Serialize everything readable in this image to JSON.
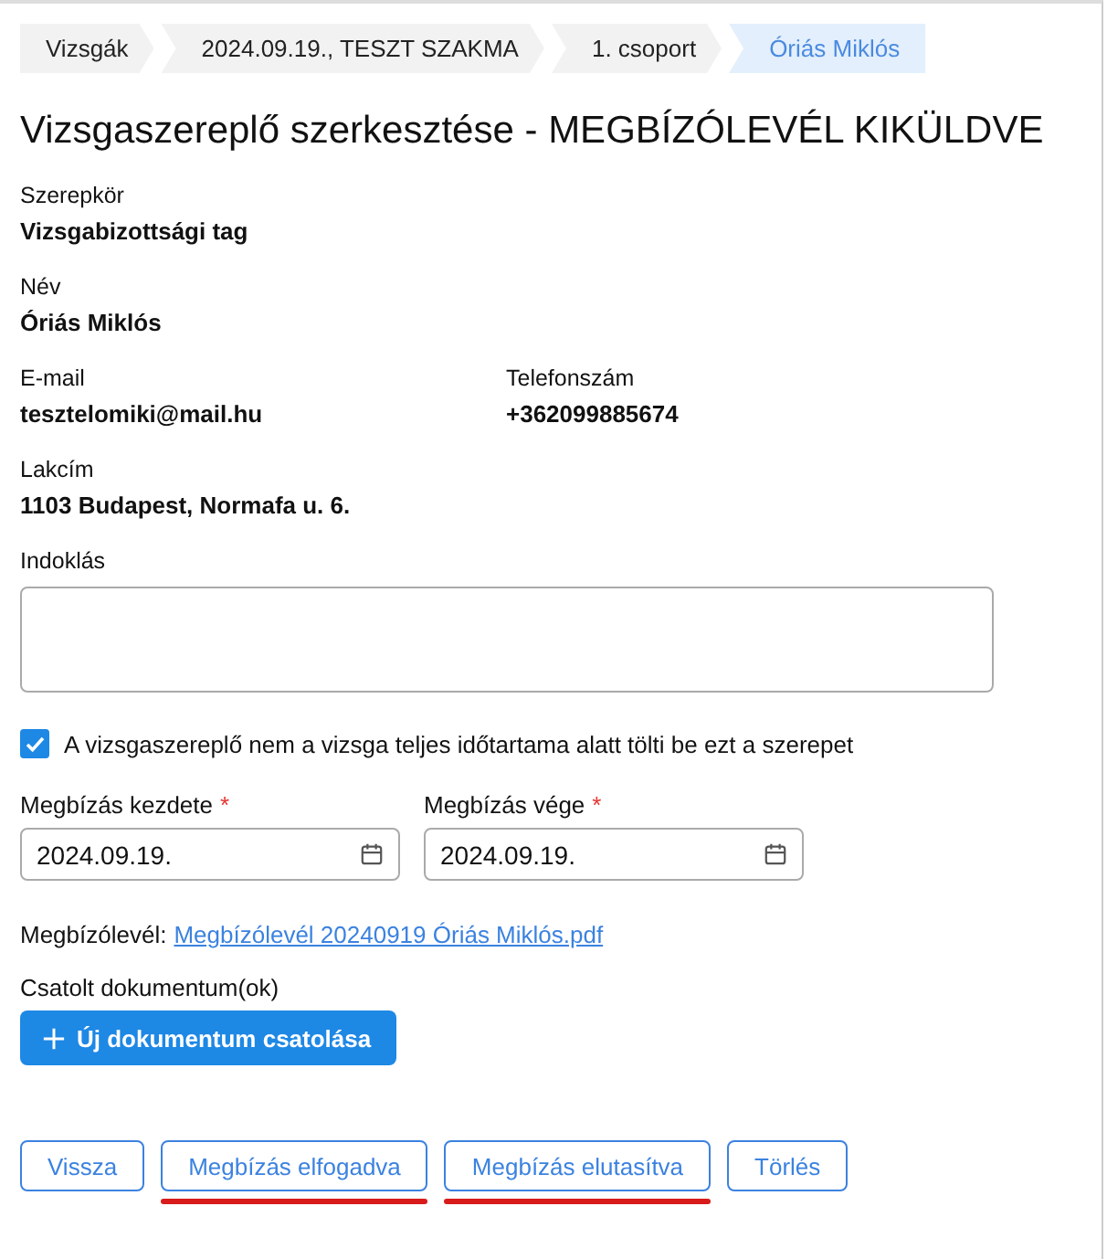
{
  "breadcrumb": [
    {
      "label": "Vizsgák",
      "selected": false
    },
    {
      "label": "2024.09.19., TESZT SZAKMA",
      "selected": false
    },
    {
      "label": "1. csoport",
      "selected": false
    },
    {
      "label": "Óriás Miklós",
      "selected": true
    }
  ],
  "title": "Vizsgaszereplő szerkesztése - MEGBÍZÓLEVÉL KIKÜLDVE",
  "info_rows": [
    [
      {
        "label": "Szerepkör",
        "value": "Vizsgabizottsági tag"
      }
    ],
    [
      {
        "label": "Név",
        "value": "Óriás Miklós"
      }
    ],
    [
      {
        "label": "E-mail",
        "value": "tesztelomiki@mail.hu"
      },
      {
        "label": "Telefonszám",
        "value": "+362099885674"
      }
    ],
    [
      {
        "label": "Lakcím",
        "value": "1103 Budapest, Normafa u. 6."
      }
    ]
  ],
  "justification": {
    "label": "Indoklás"
  },
  "partial_checkbox": {
    "label": "A vizsgaszereplő nem a vizsga teljes időtartama alatt tölti be ezt a szerepet",
    "checked": true
  },
  "dates": [
    {
      "label": "Megbízás kezdete",
      "required_mark": "*",
      "value": "2024.09.19."
    },
    {
      "label": "Megbízás vége",
      "required_mark": "*",
      "value": "2024.09.19."
    }
  ],
  "letter": {
    "label": "Megbízólevél:",
    "link": "Megbízólevél 20240919 Óriás Miklós.pdf"
  },
  "attachments": {
    "label": "Csatolt dokumentum(ok)",
    "button": "Új dokumentum csatolása"
  },
  "actions": [
    {
      "label": "Vissza",
      "highlighted": false
    },
    {
      "label": "Megbízás elfogadva",
      "highlighted": true
    },
    {
      "label": "Megbízás elutasítva",
      "highlighted": true
    },
    {
      "label": "Törlés",
      "highlighted": false
    }
  ]
}
